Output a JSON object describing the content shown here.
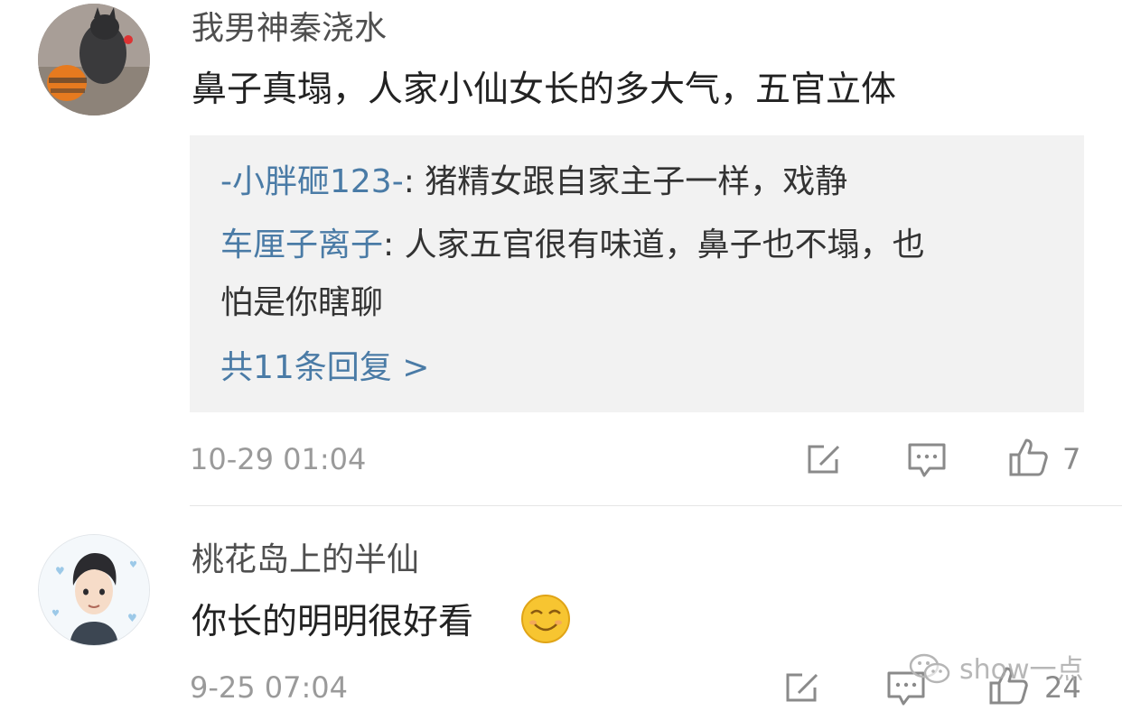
{
  "comments": [
    {
      "username": "我男神秦浇水",
      "text": "鼻子真塌，人家小仙女长的多大气，五官立体",
      "replies": [
        {
          "name": "-小胖砸123-",
          "sep": ": ",
          "text": "猪精女跟自家主子一样，戏静"
        },
        {
          "name": "车厘子离子",
          "sep": ": ",
          "text_line1": "人家五官很有味道，鼻子也不塌，也",
          "text_line2": "怕是你瞎聊"
        }
      ],
      "more_replies": "共11条回复 >",
      "time": "10-29 01:04",
      "like_count": "7"
    },
    {
      "username": "桃花岛上的半仙",
      "text": "你长的明明很好看",
      "emoji": "smiling-face-emoji",
      "time": "9-25 07:04",
      "like_count": "24"
    }
  ],
  "watermark": "show一点",
  "icons": {
    "share": "share-icon",
    "comment": "comment-icon",
    "like": "thumbs-up-icon"
  },
  "colors": {
    "username": "#4f4f4f",
    "reply_name": "#4a7ba6",
    "reply_bg": "#f2f2f2",
    "time": "#9a9a9a"
  }
}
